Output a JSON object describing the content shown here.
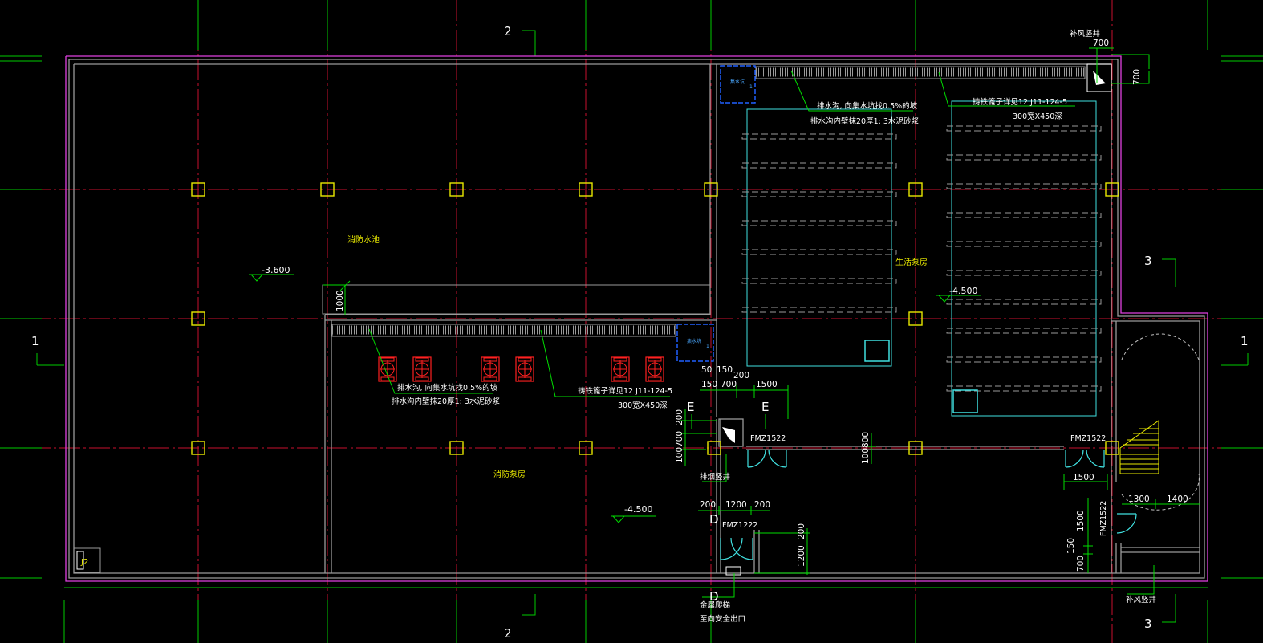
{
  "axes": {
    "top_2": "2",
    "bottom_2": "2",
    "left_1": "1",
    "right_1": "1",
    "right_3": "3",
    "bottom_3": "3"
  },
  "rooms": {
    "fire_pool": "消防水池",
    "fire_pump_room": "消防泵房",
    "domestic_pump_room": "生活泵房"
  },
  "elevations": {
    "pool": "-3.600",
    "fire_pump": "-4.500",
    "domestic_pump": "-4.500"
  },
  "notes": {
    "top_trench_1": "排水沟, 向集水坑找0.5%的坡",
    "top_trench_2": "排水沟内壁抹20厚1: 3水泥砂浆",
    "top_grate_1": "铸铁篦子详见12 J11-124-5",
    "top_grate_2": "300宽X450深",
    "mid_trench_1": "排水沟, 向集水坑找0.5%的坡",
    "mid_trench_2": "排水沟内壁抹20厚1: 3水泥砂浆",
    "mid_grate_1": "铸铁篦子详见12 J11-124-5",
    "mid_grate_2": "300宽X450深",
    "supply_shaft": "补风竖井",
    "supply_shaft_2": "补风竖井",
    "exhaust_shaft": "排烟竖井",
    "ladder_1": "金属爬梯",
    "ladder_2": "至向安全出口",
    "sump_a": "集水坑",
    "sump_b": "集水坑",
    "sump_num_a": "1",
    "sump_num_b": "1",
    "pit_tag": "J2"
  },
  "doors": {
    "d1": "FMZ1522",
    "d2": "FMZ1522",
    "d3": "FMZ1222",
    "d4": "FMZ1522"
  },
  "section_marks": {
    "e_left": "E",
    "e_right": "E",
    "d_top": "D",
    "d_bottom": "D"
  },
  "dimensions": {
    "shaft_w": "700",
    "shaft_h": "700",
    "wall_1000": "1000",
    "d50": "50",
    "d150a": "150",
    "d200a": "200",
    "d150b": "150",
    "d700a": "700",
    "d1500a": "1500",
    "d200b": "200",
    "d700b": "700",
    "d100a": "100",
    "d100b": "100",
    "d800": "800",
    "d1500b": "1500",
    "d200c": "200",
    "d1200a": "1200",
    "d200d": "200",
    "d200e": "200",
    "d1200b": "1200",
    "d1300": "1300",
    "d1400": "1400",
    "d1500c": "1500",
    "d150c": "150",
    "d700c": "700"
  },
  "colors": {
    "background": "#000000",
    "grid_axis": "#c8102e",
    "grid_ext": "#00cc00",
    "outer_wall": "#e040e0",
    "wall": "#9a9a9a",
    "column": "#e8e800",
    "equipment": "#40e0e0",
    "pump": "#ff2020",
    "sump": "#2060ff",
    "dimension": "#00dd00"
  }
}
